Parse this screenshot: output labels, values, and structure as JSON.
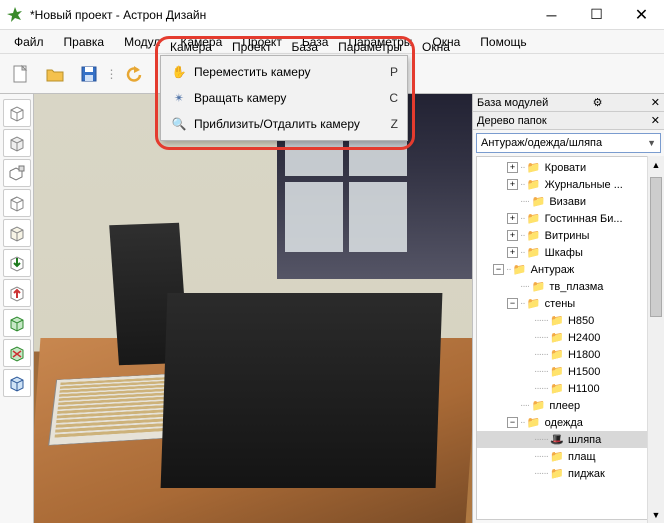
{
  "title": "*Новый проект - Астрон Дизайн",
  "menu": {
    "file": "Файл",
    "edit": "Правка",
    "modules": "Модул",
    "camera": "Камера",
    "project": "Проект",
    "base": "База",
    "params": "Параметры",
    "windows": "Окна",
    "help": "Помощь"
  },
  "dropdown": {
    "move": "Переместить камеру",
    "move_key": "P",
    "rotate": "Вращать камеру",
    "rotate_key": "C",
    "zoom": "Приблизить/Отдалить камеру",
    "zoom_key": "Z"
  },
  "right": {
    "db_title": "База модулей",
    "tree_title": "Дерево папок",
    "combo": "Антураж/одежда/шляпа"
  },
  "tree": {
    "n0": "Кровати",
    "n1": "Журнальные ...",
    "n2": "Визави",
    "n3": "Гостинная Би...",
    "n4": "Витрины",
    "n5": "Шкафы",
    "n6": "Антураж",
    "n7": "тв_плазма",
    "n8": "стены",
    "n9": "H850",
    "n10": "H2400",
    "n11": "H1800",
    "n12": "H1500",
    "n13": "H1100",
    "n14": "плеер",
    "n15": "одежда",
    "n16": "шляпа",
    "n17": "плащ",
    "n18": "пиджак"
  }
}
